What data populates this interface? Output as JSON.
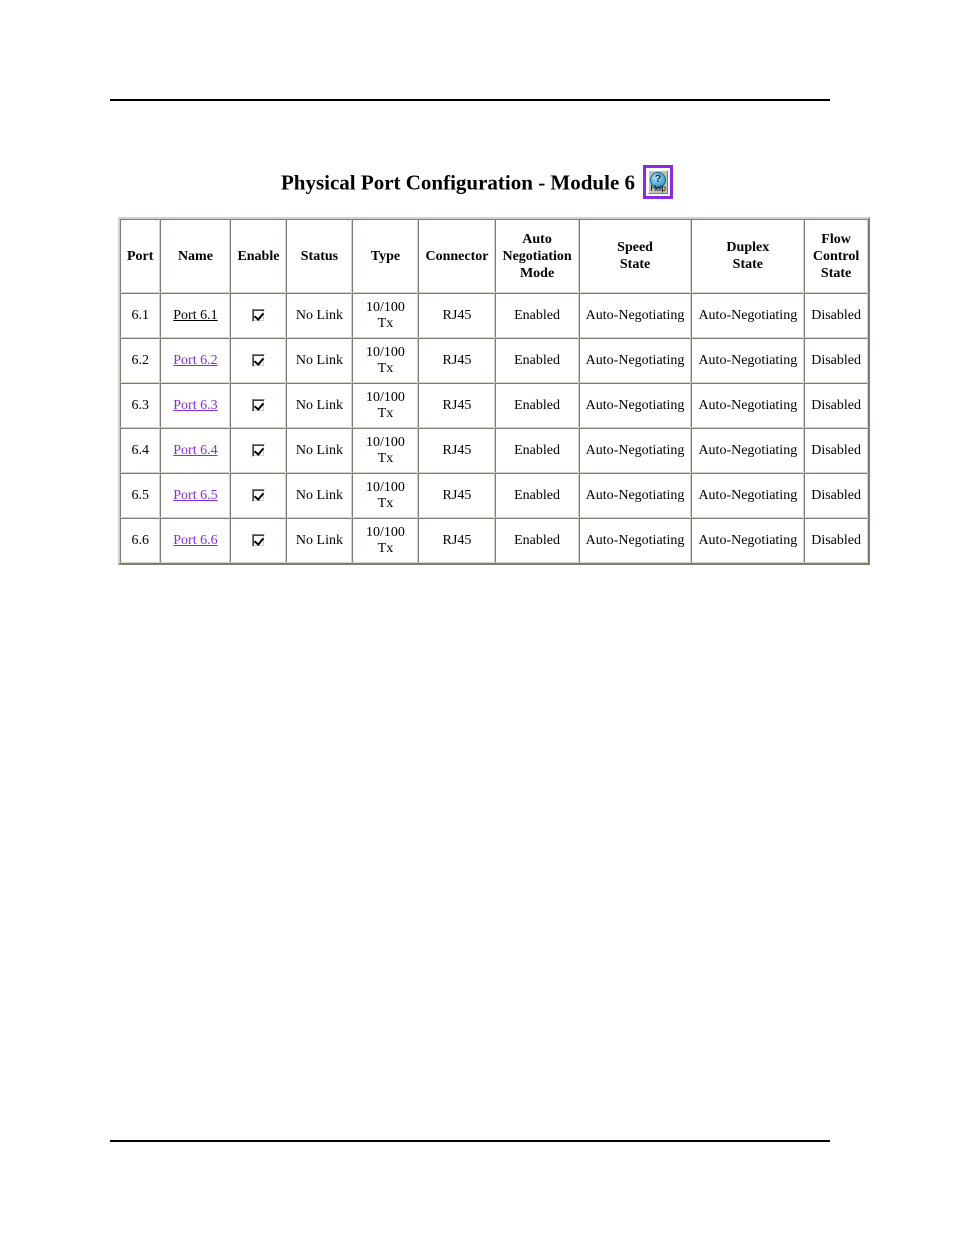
{
  "page": {
    "header_rule": true,
    "footer_rule": true
  },
  "title": {
    "text": "Physical Port Configuration - Module 6",
    "help_button": {
      "name": "help-button",
      "label": "Help",
      "glyph": "?",
      "border_color": "#8a2be2",
      "face_color": "#c0c0c0"
    }
  },
  "table": {
    "columns": [
      {
        "key": "port",
        "label": "Port"
      },
      {
        "key": "name",
        "label": "Name"
      },
      {
        "key": "enable",
        "label": "Enable"
      },
      {
        "key": "status",
        "label": "Status"
      },
      {
        "key": "type",
        "label": "Type"
      },
      {
        "key": "connector",
        "label": "Connector"
      },
      {
        "key": "autoneg",
        "label": "Auto Negotiation Mode"
      },
      {
        "key": "speed",
        "label": "Speed State"
      },
      {
        "key": "duplex",
        "label": "Duplex State"
      },
      {
        "key": "flow",
        "label": "Flow Control State"
      }
    ],
    "header_lines": {
      "port": [
        "Port"
      ],
      "name": [
        "Name"
      ],
      "enable": [
        "Enable"
      ],
      "status": [
        "Status"
      ],
      "type": [
        "Type"
      ],
      "connector": [
        "Connector"
      ],
      "autoneg": [
        "Auto",
        "Negotiation",
        "Mode"
      ],
      "speed": [
        "Speed",
        "State"
      ],
      "duplex": [
        "Duplex",
        "State"
      ],
      "flow": [
        "Flow",
        "Control",
        "State"
      ]
    },
    "rows": [
      {
        "port": "6.1",
        "name": "Port 6.1",
        "name_link_state": "active",
        "enable_checked": true,
        "status": "No Link",
        "type_line1": "10/100",
        "type_line2": "Tx",
        "connector": "RJ45",
        "autoneg": "Enabled",
        "speed": "Auto-Negotiating",
        "duplex": "Auto-Negotiating",
        "flow": "Disabled"
      },
      {
        "port": "6.2",
        "name": "Port 6.2",
        "name_link_state": "visited",
        "enable_checked": true,
        "status": "No Link",
        "type_line1": "10/100",
        "type_line2": "Tx",
        "connector": "RJ45",
        "autoneg": "Enabled",
        "speed": "Auto-Negotiating",
        "duplex": "Auto-Negotiating",
        "flow": "Disabled"
      },
      {
        "port": "6.3",
        "name": "Port 6.3",
        "name_link_state": "visited",
        "enable_checked": true,
        "status": "No Link",
        "type_line1": "10/100",
        "type_line2": "Tx",
        "connector": "RJ45",
        "autoneg": "Enabled",
        "speed": "Auto-Negotiating",
        "duplex": "Auto-Negotiating",
        "flow": "Disabled"
      },
      {
        "port": "6.4",
        "name": "Port 6.4",
        "name_link_state": "visited",
        "enable_checked": true,
        "status": "No Link",
        "type_line1": "10/100",
        "type_line2": "Tx",
        "connector": "RJ45",
        "autoneg": "Enabled",
        "speed": "Auto-Negotiating",
        "duplex": "Auto-Negotiating",
        "flow": "Disabled"
      },
      {
        "port": "6.5",
        "name": "Port 6.5",
        "name_link_state": "visited",
        "enable_checked": true,
        "status": "No Link",
        "type_line1": "10/100",
        "type_line2": "Tx",
        "connector": "RJ45",
        "autoneg": "Enabled",
        "speed": "Auto-Negotiating",
        "duplex": "Auto-Negotiating",
        "flow": "Disabled"
      },
      {
        "port": "6.6",
        "name": "Port 6.6",
        "name_link_state": "visited",
        "enable_checked": true,
        "status": "No Link",
        "type_line1": "10/100",
        "type_line2": "Tx",
        "connector": "RJ45",
        "autoneg": "Enabled",
        "speed": "Auto-Negotiating",
        "duplex": "Auto-Negotiating",
        "flow": "Disabled"
      }
    ]
  },
  "colors": {
    "link_active": "#000000",
    "link_visited": "#8a2be2",
    "text": "#000000",
    "background": "#ffffff",
    "rule": "#000000"
  }
}
